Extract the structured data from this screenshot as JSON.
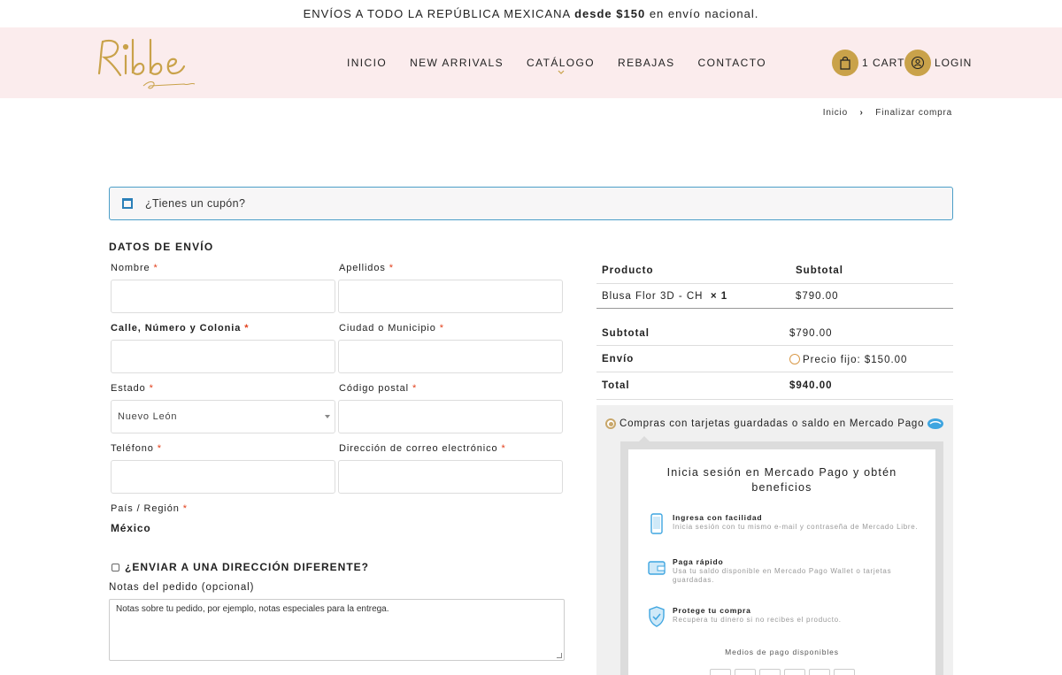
{
  "topbar": {
    "text_prefix": "ENVÍOS A TODO LA REPÚBLICA MEXICANA",
    "text_bold": "desde $150",
    "text_suffix": "en envío nacional."
  },
  "header": {
    "brand_colors": {
      "gold": "#c9a24a",
      "pink_bg": "#fbeced"
    },
    "nav": [
      "INICIO",
      "NEW ARRIVALS",
      "CATÁLOGO",
      "REBAJAS",
      "CONTACTO"
    ],
    "cart_label": "1 CART",
    "login_label": "LOGIN",
    "icons": {
      "cart": "shopping-bag-icon",
      "login": "user-icon"
    }
  },
  "breadcrumb": {
    "home": "Inicio",
    "sep": "›",
    "current": "Finalizar compra"
  },
  "coupon": {
    "text": "¿Tienes un cupón?",
    "icon": "calendar-icon"
  },
  "billing": {
    "title": "DATOS DE ENVÍO",
    "nombre": "Nombre",
    "apellidos": "Apellidos",
    "calle": "Calle, Número y Colonia",
    "ciudad": "Ciudad o Municipio",
    "estado": "Estado",
    "estado_value": "Nuevo León",
    "cp": "Código postal",
    "telefono": "Teléfono",
    "email": "Dirección de correo electrónico",
    "pais": "País / Región",
    "pais_value": "México",
    "required": "*",
    "ship_diff": "¿ENVIAR A UNA DIRECCIÓN DIFERENTE?",
    "notes_label": "Notas del pedido (opcional)",
    "notes_placeholder": "Notas sobre tu pedido, por ejemplo, notas especiales para la entrega."
  },
  "order": {
    "col_product": "Producto",
    "col_subtotal": "Subtotal",
    "item_name": "Blusa Flor 3D - CH",
    "item_qty": "× 1",
    "item_price": "$790.00",
    "subtotal_label": "Subtotal",
    "subtotal_value": "$790.00",
    "envio_label": "Envío",
    "envio_value": "Precio fijo: $150.00",
    "total_label": "Total",
    "total_value": "$940.00"
  },
  "payment": {
    "option_label": "Compras con tarjetas guardadas o saldo en Mercado Pago",
    "mp_title_1": "Inicia sesión en Mercado Pago  y obtén",
    "mp_title_2": "beneficios",
    "items": [
      {
        "title": "Ingresa con facilidad",
        "desc": "Inicia sesión con tu mismo e-mail y contraseña de Mercado Libre.",
        "icon": "phone-icon"
      },
      {
        "title": "Paga rápido",
        "desc": "Usa tu saldo disponible en Mercado Pago Wallet o tarjetas guardadas.",
        "icon": "wallet-icon"
      },
      {
        "title": "Protege tu compra",
        "desc": "Recupera tu dinero si no recibes el producto.",
        "icon": "shield-icon"
      }
    ],
    "methods_label": "Medios de pago disponibles"
  }
}
